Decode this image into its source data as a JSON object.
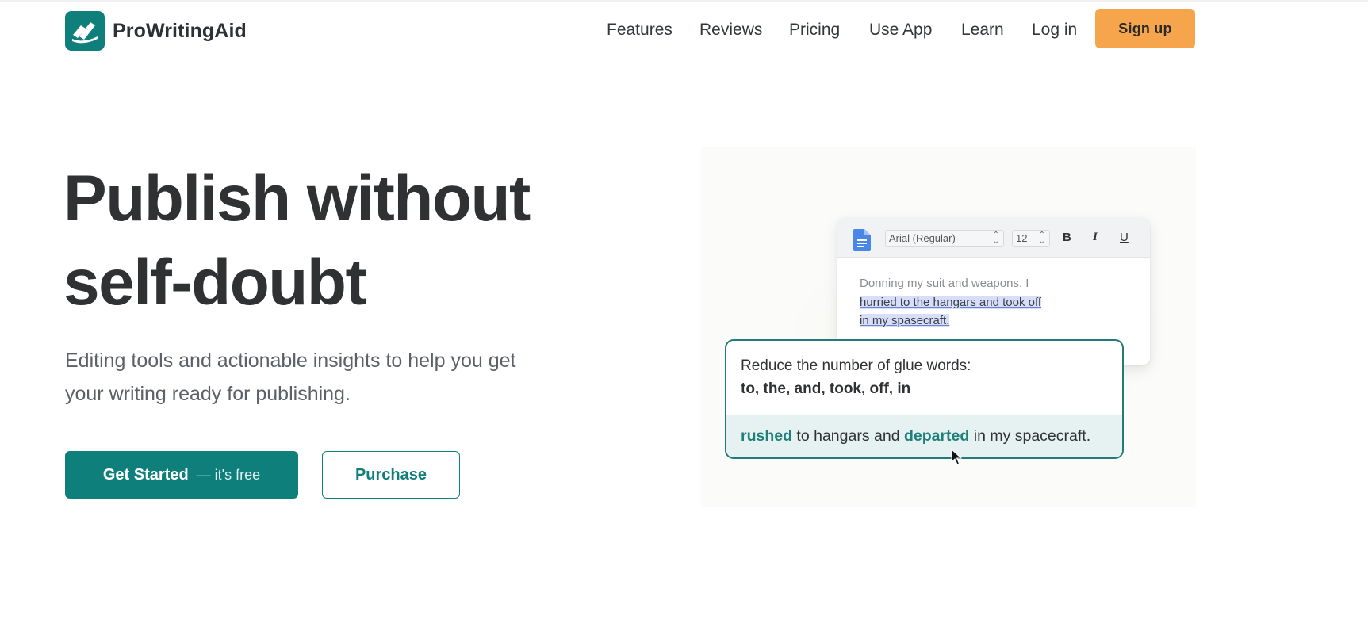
{
  "brand": {
    "name": "ProWritingAid",
    "accent": "#0f7f7c",
    "cta_color": "#f6a54d"
  },
  "nav": {
    "items": [
      {
        "label": "Features"
      },
      {
        "label": "Reviews"
      },
      {
        "label": "Pricing"
      },
      {
        "label": "Use App"
      },
      {
        "label": "Learn"
      },
      {
        "label": "Log in"
      }
    ],
    "signup_label": "Sign up"
  },
  "hero": {
    "headline_line1": "Publish without",
    "headline_line2": "self-doubt",
    "subtext_line1": "Editing tools and actionable insights to help you get",
    "subtext_line2": "your writing ready for publishing.",
    "primary_label": "Get Started",
    "primary_suffix": "— it's free",
    "secondary_label": "Purchase"
  },
  "editor": {
    "font": "Arial (Regular)",
    "size": "12",
    "bold": "B",
    "italic": "I",
    "underline": "U",
    "text_plain": "Donning my suit and weapons, I",
    "text_highlight_1": "hurried to the hangars and took off",
    "text_highlight_2": "in my spasecraft."
  },
  "suggestion": {
    "title": "Reduce the number of glue words:",
    "words": "to, the, and, took, off, in",
    "word1": "rushed",
    "mid": " to hangars and ",
    "word2": "departed",
    "tail": " in my spacecraft."
  }
}
